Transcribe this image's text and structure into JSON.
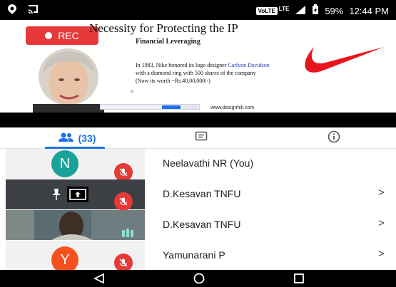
{
  "status_bar": {
    "volte": "VoLTE",
    "lte": "LTE",
    "battery": "59%",
    "time": "12:44 PM"
  },
  "slide": {
    "rec_label": "REC",
    "title": "Necessity for Protecting the IP",
    "subtitle": "Financial Leveraging",
    "line1": "In 1983, Nike honored its logo designer",
    "designer": "Carlyon Davidson",
    "line2": "with a diamond ring with 500 shares of the company",
    "line3": "(Now its worth ~Rs.40,00,000/-)",
    "website": "www.designhill.com",
    "mark": "fx"
  },
  "tabs": {
    "people_count": "(33)",
    "chat": "chat",
    "info": "info"
  },
  "participants": [
    {
      "initial": "N",
      "name": "Neelavathi NR (You)",
      "avatar_color": "#1aa198"
    },
    {
      "initial": "",
      "name": "D.Kesavan TNFU"
    },
    {
      "initial": "",
      "name": "D.Kesavan TNFU"
    },
    {
      "initial": "Y",
      "name": "Yamunarani P",
      "avatar_color": "#f4511e"
    }
  ],
  "chevron": ">",
  "colors": {
    "accent": "#1a73e8",
    "rec": "#e6393a",
    "mute": "#e53935"
  }
}
